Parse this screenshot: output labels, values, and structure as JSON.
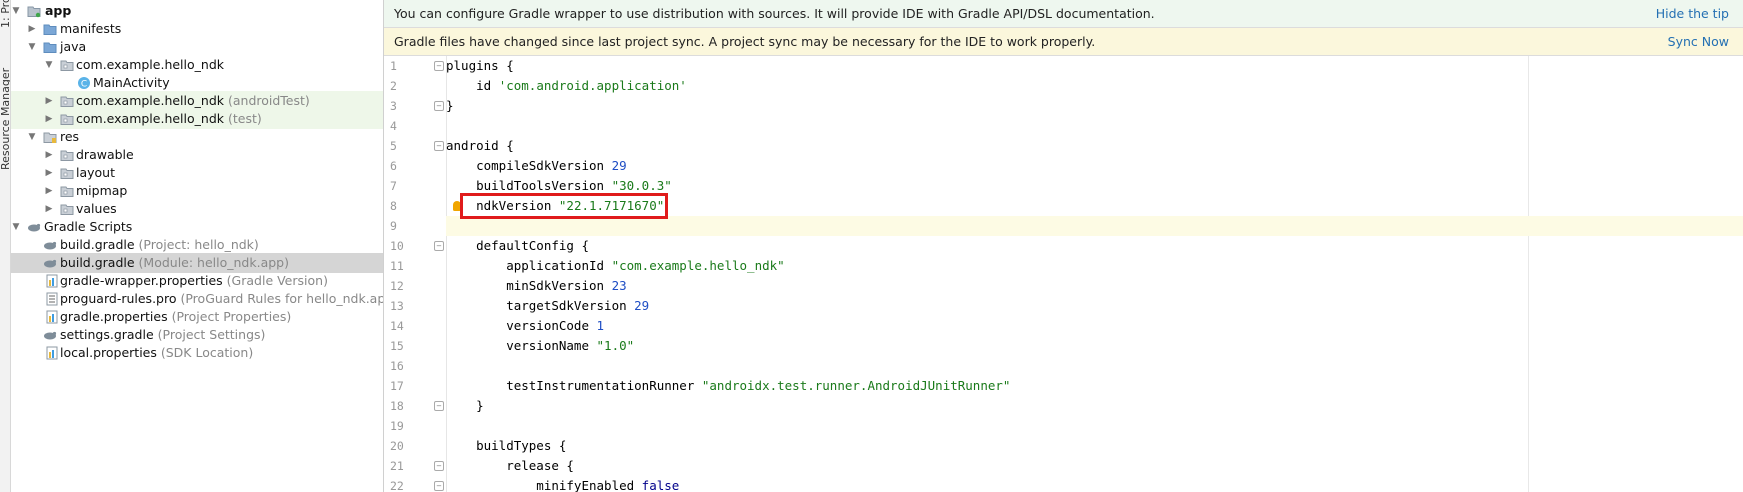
{
  "side_strip": {
    "label_1": "1: Pro",
    "label_2": "Resource Manager"
  },
  "tree": {
    "rows": [
      {
        "label": "app",
        "hint": ""
      },
      {
        "label": "manifests",
        "hint": ""
      },
      {
        "label": "java",
        "hint": ""
      },
      {
        "label": "com.example.hello_ndk",
        "hint": ""
      },
      {
        "label": "MainActivity",
        "hint": ""
      },
      {
        "label": "com.example.hello_ndk",
        "hint": "(androidTest)"
      },
      {
        "label": "com.example.hello_ndk",
        "hint": "(test)"
      },
      {
        "label": "res",
        "hint": ""
      },
      {
        "label": "drawable",
        "hint": ""
      },
      {
        "label": "layout",
        "hint": ""
      },
      {
        "label": "mipmap",
        "hint": ""
      },
      {
        "label": "values",
        "hint": ""
      },
      {
        "label": "Gradle Scripts",
        "hint": ""
      },
      {
        "label": "build.gradle",
        "hint": "(Project: hello_ndk)"
      },
      {
        "label": "build.gradle",
        "hint": "(Module: hello_ndk.app)"
      },
      {
        "label": "gradle-wrapper.properties",
        "hint": "(Gradle Version)"
      },
      {
        "label": "proguard-rules.pro",
        "hint": "(ProGuard Rules for hello_ndk.app)"
      },
      {
        "label": "gradle.properties",
        "hint": "(Project Properties)"
      },
      {
        "label": "settings.gradle",
        "hint": "(Project Settings)"
      },
      {
        "label": "local.properties",
        "hint": "(SDK Location)"
      }
    ]
  },
  "banners": {
    "tip": {
      "text": "You can configure Gradle wrapper to use distribution with sources. It will provide IDE with Gradle API/DSL documentation.",
      "action": "Hide the tip"
    },
    "sync": {
      "text": "Gradle files have changed since last project sync. A project sync may be necessary for the IDE to work properly.",
      "action": "Sync Now"
    }
  },
  "editor": {
    "line_numbers": [
      "1",
      "2",
      "3",
      "4",
      "5",
      "6",
      "7",
      "8",
      "9",
      "10",
      "11",
      "12",
      "13",
      "14",
      "15",
      "16",
      "17",
      "18",
      "19",
      "20",
      "21",
      "22"
    ],
    "lines": [
      {
        "t": "plugins {"
      },
      {
        "t": "    id ",
        "s": "'com.android.application'"
      },
      {
        "t": "}"
      },
      {
        "t": ""
      },
      {
        "t": "android {"
      },
      {
        "t": "    compileSdkVersion ",
        "n": "29"
      },
      {
        "t": "    buildToolsVersion ",
        "s": "\"30.0.3\""
      },
      {
        "t": "    ndkVersion ",
        "s": "\"22.1.7171670\""
      },
      {
        "t": ""
      },
      {
        "t": "    defaultConfig {"
      },
      {
        "t": "        applicationId ",
        "s": "\"com.example.hello_ndk\""
      },
      {
        "t": "        minSdkVersion ",
        "n": "23"
      },
      {
        "t": "        targetSdkVersion ",
        "n": "29"
      },
      {
        "t": "        versionCode ",
        "n": "1"
      },
      {
        "t": "        versionName ",
        "s": "\"1.0\""
      },
      {
        "t": ""
      },
      {
        "t": "        testInstrumentationRunner ",
        "s": "\"androidx.test.runner.AndroidJUnitRunner\""
      },
      {
        "t": "    }"
      },
      {
        "t": ""
      },
      {
        "t": "    buildTypes {"
      },
      {
        "t": "        release {"
      },
      {
        "t": "            minifyEnabled ",
        "k": "false"
      }
    ]
  },
  "colors": {
    "highlight_box": "#e01b1b",
    "tip_banner_bg": "#eef7ef",
    "sync_banner_bg": "#fbf7dc",
    "link": "#2470b3",
    "selected_row": "#d5d5d5"
  }
}
